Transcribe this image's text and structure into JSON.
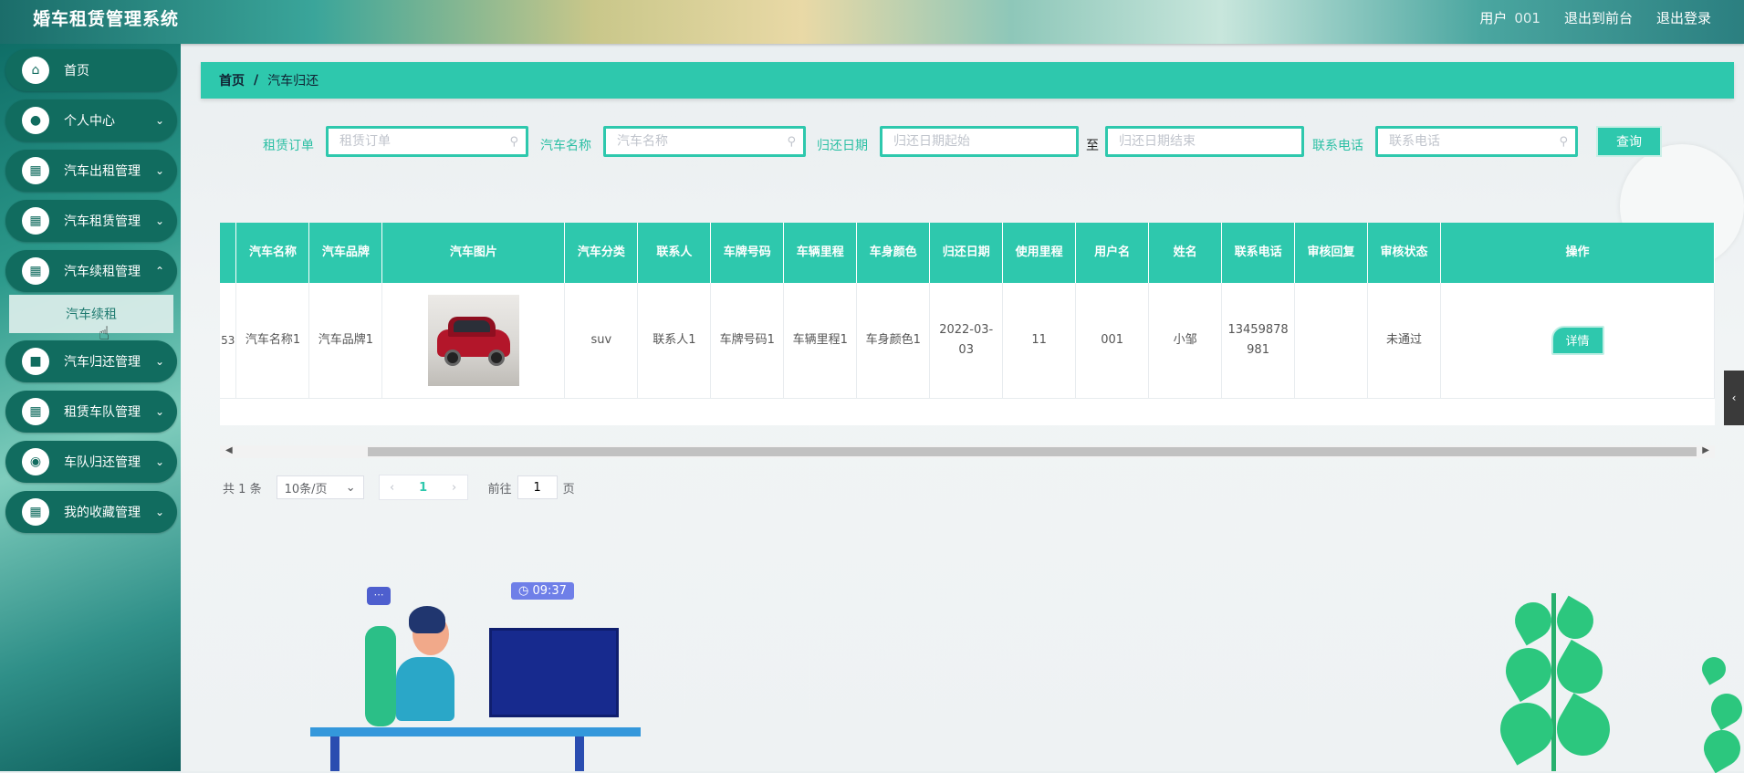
{
  "app": {
    "title": "婚车租赁管理系统",
    "user_label": "用户",
    "user_value": "001",
    "go_front": "退出到前台",
    "logout": "退出登录"
  },
  "sidebar": {
    "items": [
      {
        "label": "首页",
        "icon": "home-icon",
        "has_caret": false
      },
      {
        "label": "个人中心",
        "icon": "user-icon",
        "has_caret": true
      },
      {
        "label": "汽车出租管理",
        "icon": "briefcase-icon",
        "has_caret": true
      },
      {
        "label": "汽车租赁管理",
        "icon": "grid-icon",
        "has_caret": true
      },
      {
        "label": "汽车续租管理",
        "icon": "grid-icon",
        "has_caret": true
      },
      {
        "label": "汽车归还管理",
        "icon": "chat-icon",
        "has_caret": true
      },
      {
        "label": "租赁车队管理",
        "icon": "grid-icon",
        "has_caret": true
      },
      {
        "label": "车队归还管理",
        "icon": "bulb-icon",
        "has_caret": true
      },
      {
        "label": "我的收藏管理",
        "icon": "grid-icon",
        "has_caret": true
      }
    ],
    "sub_item": "汽车续租"
  },
  "breadcrumb": {
    "home": "首页",
    "separator": "/",
    "current": "汽车归还"
  },
  "search": {
    "order_label": "租赁订单",
    "order_placeholder": "租赁订单",
    "car_name_label": "汽车名称",
    "car_name_placeholder": "汽车名称",
    "return_date_label": "归还日期",
    "date_start_placeholder": "归还日期起始",
    "date_to": "至",
    "date_end_placeholder": "归还日期结束",
    "phone_label": "联系电话",
    "phone_placeholder": "联系电话",
    "query_button": "查询"
  },
  "table": {
    "headers": [
      "汽车名称",
      "汽车品牌",
      "汽车图片",
      "汽车分类",
      "联系人",
      "车牌号码",
      "车辆里程",
      "车身颜色",
      "归还日期",
      "使用里程",
      "用户名",
      "姓名",
      "联系电话",
      "审核回复",
      "审核状态",
      "操作"
    ],
    "row": {
      "cut_prefix": "53",
      "car_name": "汽车名称1",
      "car_brand": "汽车品牌1",
      "car_category": "suv",
      "contact": "联系人1",
      "plate": "车牌号码1",
      "mileage": "车辆里程1",
      "color": "车身颜色1",
      "return_date": "2022-03-03",
      "used_mileage": "11",
      "username": "001",
      "name": "小邹",
      "phone": "13459878981",
      "review_reply": "",
      "review_status": "未通过",
      "action": "详情"
    }
  },
  "pagination": {
    "total_prefix": "共",
    "total": "1",
    "total_suffix": "条",
    "page_size": "10条/页",
    "current_page": "1",
    "goto_prefix": "前往",
    "goto_value": "1",
    "goto_suffix": "页"
  },
  "decor": {
    "time": "09:37"
  },
  "colors": {
    "accent": "#2ec8ad",
    "sidebar_item": "#116c5f"
  }
}
